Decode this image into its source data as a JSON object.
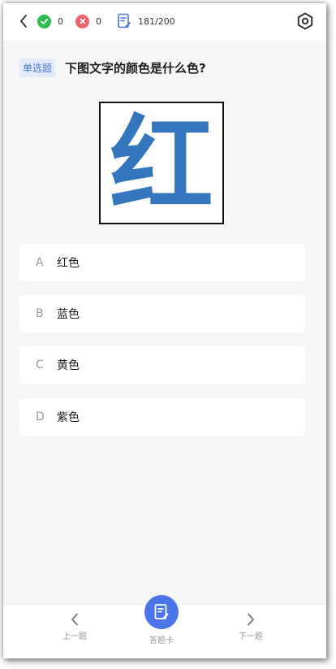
{
  "header": {
    "correct_count": "0",
    "wrong_count": "0",
    "progress": "181/200"
  },
  "question": {
    "type_label": "单选题",
    "text": "下图文字的颜色是什么色?",
    "image_char": "红",
    "image_char_color": "#3476be"
  },
  "options": [
    {
      "letter": "A",
      "text": "红色"
    },
    {
      "letter": "B",
      "text": "蓝色"
    },
    {
      "letter": "C",
      "text": "黄色"
    },
    {
      "letter": "D",
      "text": "紫色"
    }
  ],
  "footer": {
    "prev_label": "上一题",
    "card_label": "答题卡",
    "next_label": "下一题"
  },
  "colors": {
    "accent": "#4a74e8",
    "correct": "#2fbd4d",
    "wrong": "#f0606b"
  }
}
